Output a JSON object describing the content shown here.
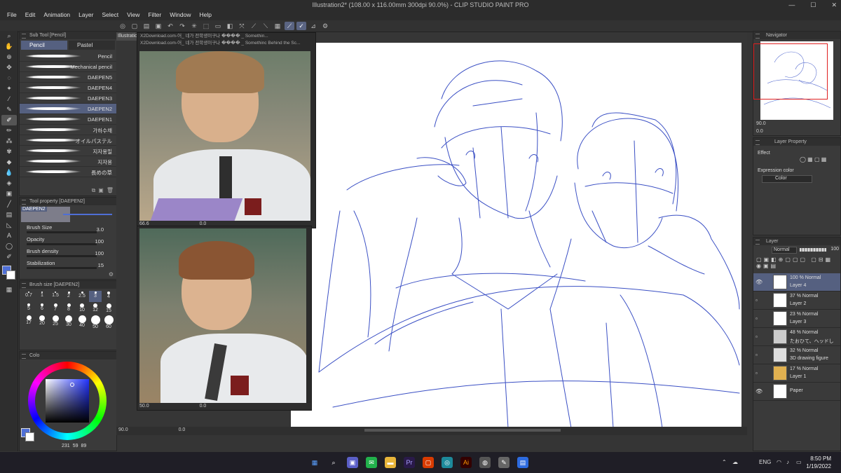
{
  "window": {
    "title": "Illustration2* (108.00 x 116.00mm 300dpi 90.0%)  - CLIP STUDIO PAINT PRO",
    "min": "—",
    "max": "☐",
    "close": "✕"
  },
  "menu": [
    "File",
    "Edit",
    "Animation",
    "Layer",
    "Select",
    "View",
    "Filter",
    "Window",
    "Help"
  ],
  "subtool": {
    "header": "Sub Tool [Pencil]",
    "tabs": [
      "Pencil",
      "Pastel"
    ],
    "brushes": [
      "Pencil",
      "Mechanical pencil",
      "DAEPEN5",
      "DAEPEN4",
      "DAEPEN3",
      "DAEPEN2",
      "DAEPEN1",
      "가하수채",
      "オイルパステル",
      "지자용밀",
      "지자용",
      "長めの草"
    ],
    "selected_index": 5
  },
  "tool_property": {
    "header": "Tool property [DAEPEN2]",
    "brush_name": "DAEPEN2",
    "rows": [
      {
        "label": "Brush Size",
        "value": "3.0"
      },
      {
        "label": "Opacity",
        "value": "100"
      },
      {
        "label": "Brush density",
        "value": "100"
      },
      {
        "label": "Stabilization",
        "value": "15"
      }
    ]
  },
  "brush_size": {
    "header": "Brush size [DAEPEN2]",
    "values": [
      "0.7",
      "1",
      "1.5",
      "2",
      "2.5",
      "3",
      "4",
      "5",
      "6",
      "7",
      "8",
      "10",
      "12",
      "15",
      "17",
      "20",
      "25",
      "30",
      "40",
      "50",
      "60"
    ],
    "selected": "3"
  },
  "color_panel": {
    "header": "Colo",
    "main_color": "#4f6fd6",
    "readout": [
      "231",
      "59",
      "89"
    ]
  },
  "canvas": {
    "tab": "Illustratio",
    "zoom": "90.0",
    "rotation": "0.0",
    "accent_line": "#3a4fc4"
  },
  "ref_windows": [
    {
      "title": "X2Download.com-어_ 네가 전학생이구나 ���� _ Somethin...",
      "zoom": "66.6",
      "rot": "0.0"
    },
    {
      "title": "X2Download.com-어_ 네가 전학생이구나 ���� _ Somethinc Behind the Sc...",
      "zoom": "50.0",
      "rot": "0.0"
    }
  ],
  "navigator": {
    "header": "Navigator",
    "zoom": "90.0",
    "rot": "0.0"
  },
  "layer_property": {
    "header": "Layer Property",
    "effect_label": "Effect",
    "expression_label": "Expression color",
    "expression_value": "Color"
  },
  "layer_panel": {
    "header": "Layer",
    "blend": "Normal",
    "opacity": "100",
    "layers": [
      {
        "opacity": "100 % Normal",
        "name": "Layer 4",
        "selected": true,
        "visible": true
      },
      {
        "opacity": "37 % Normal",
        "name": "Layer 2",
        "selected": false,
        "visible": false
      },
      {
        "opacity": "23 % Normal",
        "name": "Layer 3",
        "selected": false,
        "visible": false
      },
      {
        "opacity": "48 % Normal",
        "name": "たおひて、ヘッドし",
        "selected": false,
        "visible": false
      },
      {
        "opacity": "32 % Normal",
        "name": "3D drawing figure",
        "selected": false,
        "visible": false
      },
      {
        "opacity": "17 % Normal",
        "name": "Layer 1",
        "selected": false,
        "visible": false
      },
      {
        "opacity": "",
        "name": "Paper",
        "selected": false,
        "visible": true
      }
    ]
  },
  "taskbar": {
    "time": "8:50 PM",
    "date": "1/19/2022",
    "lang": "ENG"
  }
}
